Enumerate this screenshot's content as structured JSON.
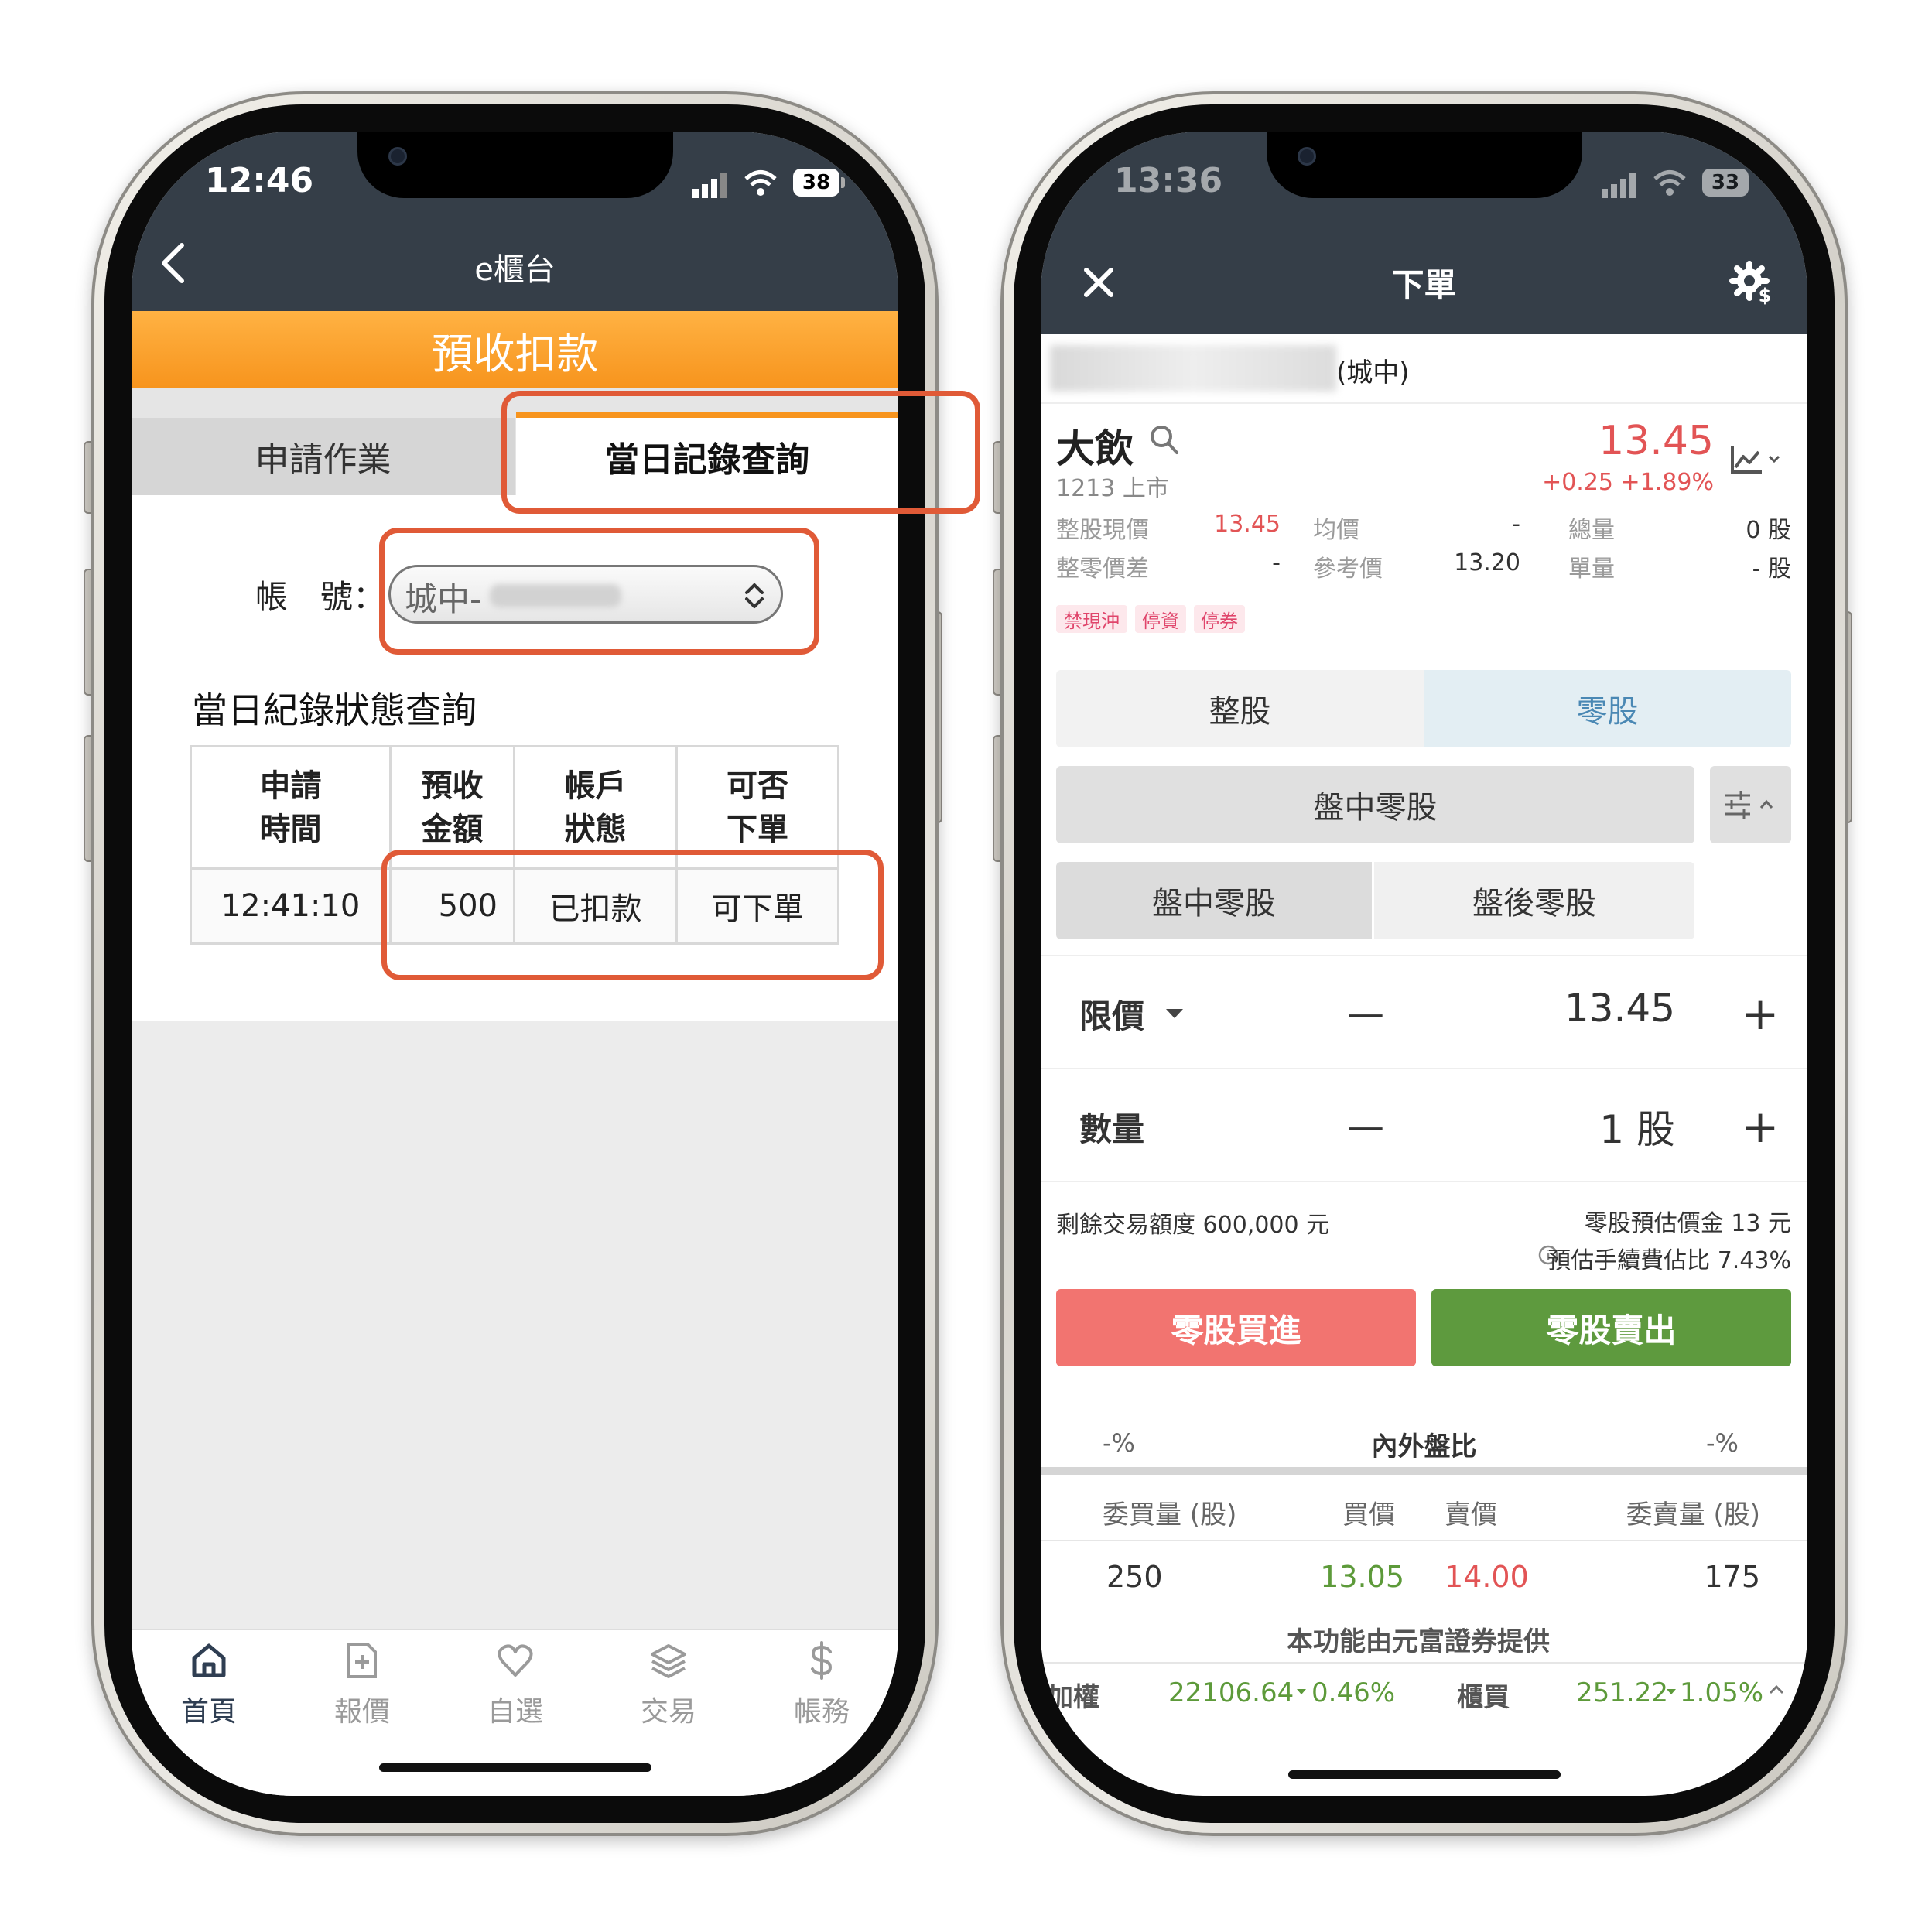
{
  "left": {
    "status_bar": {
      "time": "12:46",
      "battery": "38"
    },
    "nav": {
      "back_icon": "chevron-left-icon",
      "title": "e櫃台"
    },
    "banner": {
      "title": "預收扣款",
      "color": "#f7941d"
    },
    "tabs": [
      {
        "label": "申請作業",
        "active": false
      },
      {
        "label": "當日記錄查詢",
        "active": true
      }
    ],
    "account": {
      "label": "帳　號：",
      "value": "城中-"
    },
    "section_title": "當日紀錄狀態查詢",
    "table": {
      "headers": [
        [
          "申請",
          "時間"
        ],
        [
          "預收",
          "金額"
        ],
        [
          "帳戶",
          "狀態"
        ],
        [
          "可否",
          "下單"
        ]
      ],
      "rows": [
        [
          "12:41:10",
          "500",
          "已扣款",
          "可下單"
        ]
      ]
    },
    "bottom_nav": [
      {
        "label": "首頁",
        "icon": "home-icon",
        "active": true
      },
      {
        "label": "報價",
        "icon": "quote-doc-icon",
        "active": false
      },
      {
        "label": "自選",
        "icon": "heart-icon",
        "active": false
      },
      {
        "label": "交易",
        "icon": "layers-icon",
        "active": false
      },
      {
        "label": "帳務",
        "icon": "dollar-icon",
        "active": false
      }
    ]
  },
  "right": {
    "status_bar": {
      "time": "13:36",
      "battery": "33"
    },
    "nav": {
      "close_icon": "close-icon",
      "title": "下單",
      "settings_icon": "gear-dollar-icon"
    },
    "account_suffix": "(城中)",
    "stock": {
      "name": "大飲",
      "code_market": "1213 上市",
      "price": "13.45",
      "change": "+0.25",
      "change_pct": "+1.89%"
    },
    "stats": {
      "row1": [
        {
          "label": "整股現價",
          "value": "13.45"
        },
        {
          "label": "均價",
          "value": "-"
        },
        {
          "label": "總量",
          "value": "0 股"
        }
      ],
      "row2": [
        {
          "label": "整零價差",
          "value": "-"
        },
        {
          "label": "參考價",
          "value": "13.20"
        },
        {
          "label": "單量",
          "value": "- 股"
        }
      ]
    },
    "tags": [
      "禁現沖",
      "停資",
      "停券"
    ],
    "board_tabs": {
      "whole": "整股",
      "odd": "零股"
    },
    "session_select": "盤中零股",
    "session_tabs": {
      "intraday": "盤中零股",
      "after": "盤後零股"
    },
    "price_row": {
      "label": "限價",
      "minus": "—",
      "value": "13.45",
      "plus": "+"
    },
    "qty_row": {
      "label": "數量",
      "minus": "—",
      "value": "1 股",
      "plus": "+"
    },
    "info": {
      "remaining": "剩餘交易額度 600,000 元",
      "estimate": "零股預估價金 13 元",
      "fee": "預估手續費佔比 7.43%"
    },
    "buttons": {
      "buy": "零股買進",
      "sell": "零股賣出",
      "buy_color": "#f27470",
      "sell_color": "#5e9a3e"
    },
    "ratio": {
      "left": "-%",
      "title": "內外盤比",
      "right": "-%"
    },
    "book": {
      "headers": [
        "委買量 (股)",
        "買價",
        "賣價",
        "委賣量 (股)"
      ],
      "row": [
        "250",
        "13.05",
        "14.00",
        "175"
      ]
    },
    "provider": "本功能由元富證券提供",
    "ticker": {
      "label1": "加權",
      "value1": "22106.64",
      "pct1": "0.46%",
      "label2": "櫃買",
      "value2": "251.22",
      "pct2": "1.05%"
    }
  }
}
